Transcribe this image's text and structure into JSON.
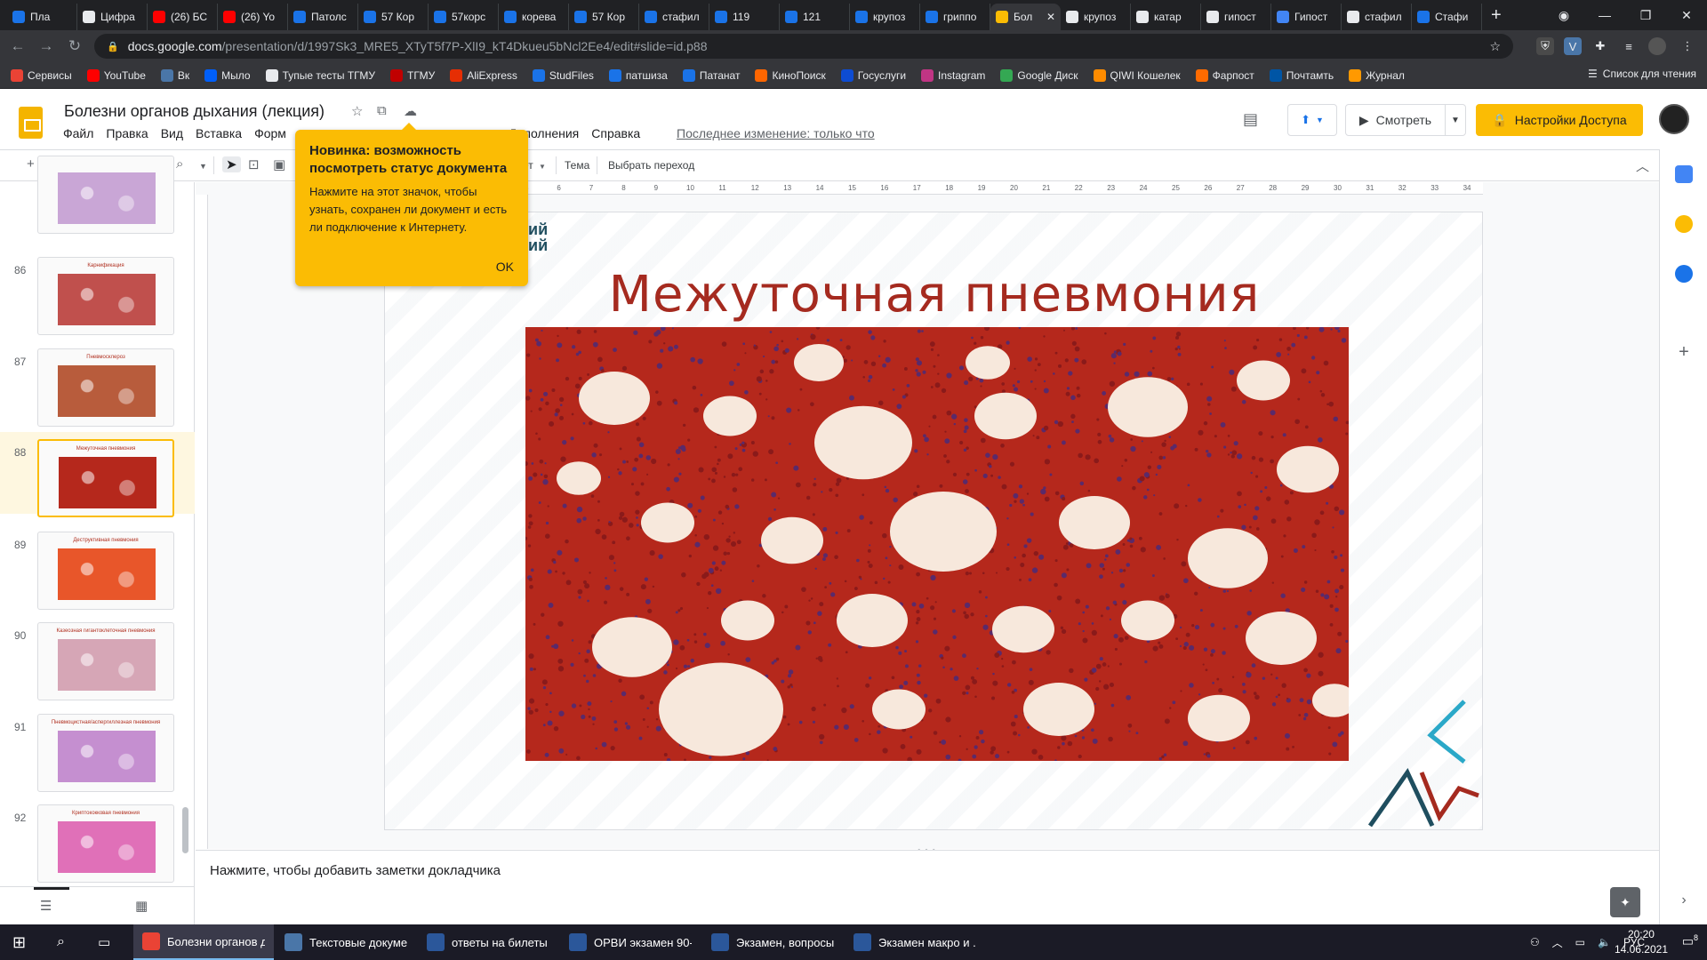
{
  "browser": {
    "tabs": [
      {
        "label": "Пла",
        "color": "#1a73e8"
      },
      {
        "label": "Цифра",
        "color": "#e8eaed"
      },
      {
        "label": "(26) БС",
        "color": "#ff0000"
      },
      {
        "label": "(26) Yo",
        "color": "#ff0000"
      },
      {
        "label": "Патолс",
        "color": "#1a73e8"
      },
      {
        "label": "57 Кор",
        "color": "#1a73e8"
      },
      {
        "label": "57корс",
        "color": "#1a73e8"
      },
      {
        "label": "корева",
        "color": "#1a73e8"
      },
      {
        "label": "57 Кор",
        "color": "#1a73e8"
      },
      {
        "label": "стафил",
        "color": "#1a73e8"
      },
      {
        "label": "119",
        "color": "#1a73e8"
      },
      {
        "label": "121",
        "color": "#1a73e8"
      },
      {
        "label": "крупоз",
        "color": "#1a73e8"
      },
      {
        "label": "гриппо",
        "color": "#1a73e8"
      },
      {
        "label": "Бол",
        "color": "#fbbc04",
        "active": true
      },
      {
        "label": "крупоз",
        "color": "#e8eaed"
      },
      {
        "label": "катар",
        "color": "#e8eaed"
      },
      {
        "label": "гипост",
        "color": "#e8eaed"
      },
      {
        "label": "Гипост",
        "color": "#4285f4"
      },
      {
        "label": "стафил",
        "color": "#e8eaed"
      },
      {
        "label": "Стафи",
        "color": "#1a73e8"
      }
    ],
    "url_domain": "docs.google.com",
    "url_path": "/presentation/d/1997Sk3_MRE5_XTyT5f7P-XlI9_kT4Dkueu5bNcl2Ee4/edit#slide=id.p88",
    "bookmarks": [
      {
        "label": "Сервисы",
        "color": "#ea4335"
      },
      {
        "label": "YouTube",
        "color": "#ff0000"
      },
      {
        "label": "Вк",
        "color": "#4a76a8"
      },
      {
        "label": "Мыло",
        "color": "#005ff9"
      },
      {
        "label": "Тупые тесты ТГМУ",
        "color": "#e8eaed"
      },
      {
        "label": "ТГМУ",
        "color": "#c00000"
      },
      {
        "label": "AliExpress",
        "color": "#e62e04"
      },
      {
        "label": "StudFiles",
        "color": "#1a73e8"
      },
      {
        "label": "патшиза",
        "color": "#1a73e8"
      },
      {
        "label": "Патанат",
        "color": "#1a73e8"
      },
      {
        "label": "КиноПоиск",
        "color": "#ff6600"
      },
      {
        "label": "Госуслуги",
        "color": "#0d4cd3"
      },
      {
        "label": "Instagram",
        "color": "#c13584"
      },
      {
        "label": "Google Диск",
        "color": "#34a853"
      },
      {
        "label": "QIWI Кошелек",
        "color": "#ff8c00"
      },
      {
        "label": "Фарпост",
        "color": "#ff6b00"
      },
      {
        "label": "Почтамть",
        "color": "#0055a5"
      },
      {
        "label": "Журнал",
        "color": "#ff9900"
      }
    ],
    "readlist": "Список для чтения"
  },
  "app": {
    "title": "Болезни органов дыхания (лекция)",
    "menu": [
      "Файл",
      "Правка",
      "Вид",
      "Вставка",
      "Форм",
      "Дополнения",
      "Справка"
    ],
    "last_edit": "Последнее изменение: только что",
    "view_button": "Смотреть",
    "share_button": "Настройки Доступа",
    "toolbar": {
      "layout": "ет",
      "theme": "Тема",
      "transition": "Выбрать переход"
    }
  },
  "tooltip": {
    "title": "Новинка: возможность посмотреть статус документа",
    "body": "Нажмите на этот значок, чтобы узнать, сохранен ли документ и есть ли подключение к Интернету.",
    "ok": "OK"
  },
  "filmstrip": [
    {
      "num": "",
      "title": "",
      "tint": "#c9a6d6"
    },
    {
      "num": "86",
      "title": "Карнификация",
      "tint": "#c0504d"
    },
    {
      "num": "87",
      "title": "Пневмосклероз",
      "tint": "#b85c3c"
    },
    {
      "num": "88",
      "title": "Межуточная пневмония",
      "tint": "#b5281c",
      "selected": true
    },
    {
      "num": "89",
      "title": "Деструктивная пневмония",
      "tint": "#e8562a"
    },
    {
      "num": "90",
      "title": "Казеозная гигантоклеточная пневмония",
      "tint": "#d6a6b6"
    },
    {
      "num": "91",
      "title": "Пневмоцистная/аспергиллезная пневмония",
      "tint": "#c58fd0"
    },
    {
      "num": "92",
      "title": "Криптококковая пневмония",
      "tint": "#e070b8"
    }
  ],
  "slide": {
    "title": "Межуточная пневмония",
    "logo_text": "кий\nкий"
  },
  "notes": {
    "placeholder": "Нажмите, чтобы добавить заметки докладчика"
  },
  "taskbar": {
    "items": [
      {
        "label": "Болезни органов д...",
        "color": "#ea4335",
        "active": true
      },
      {
        "label": "Текстовые докуме...",
        "color": "#4a76a8"
      },
      {
        "label": "ответы на билеты ...",
        "color": "#2b579a"
      },
      {
        "label": "ОРВИ экзамен 90-...",
        "color": "#2b579a"
      },
      {
        "label": "Экзамен, вопросы...",
        "color": "#2b579a"
      },
      {
        "label": "Экзамен макро и ...",
        "color": "#2b579a"
      }
    ],
    "lang": "РУС",
    "time": "20:20",
    "date": "14.06.2021",
    "notif_count": "8"
  }
}
